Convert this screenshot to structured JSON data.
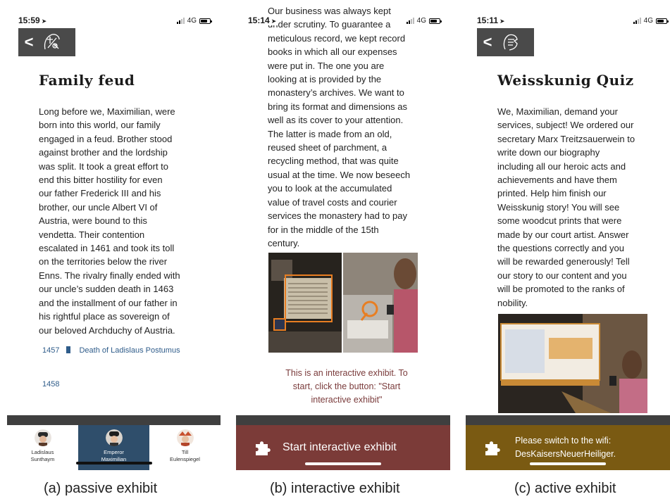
{
  "panels": {
    "passive": {
      "status": {
        "time": "15:59",
        "network": "4G"
      },
      "title": "Family feud",
      "body": "Long before we, Maximilian, were\nborn into this world, our family\nengaged in a feud. Brother stood\nagainst brother and the lordship\nwas split. It took a great effort to\nend this bitter hostility for even\nour father Frederick III and his\nbrother, our uncle Albert VI of\nAustria, were bound to this\nvendetta. Their contention\nescalated in 1461 and took its toll\non the territories below the river\nEnns. The rivalry finally ended with\nour uncle’s sudden death in 1463\nand the installment of our father in\nhis rightful place as sovereign of\nour beloved Archduchy of Austria.",
      "timeline": [
        {
          "year": "1457",
          "event": "Death of Ladislaus Postumus"
        },
        {
          "year": "1458",
          "event": ""
        }
      ],
      "tabs": [
        {
          "label_1": "Ladislaus",
          "label_2": "Sunthaym",
          "active": false
        },
        {
          "label_1": "Emperor",
          "label_2": "Maximilian",
          "active": true
        },
        {
          "label_1": "Till",
          "label_2": "Eulenspiegel",
          "active": false
        }
      ]
    },
    "interactive": {
      "status": {
        "time": "15:14",
        "network": "4G"
      },
      "body": "Our business was always kept\nunder scrutiny. To guarantee a\nmeticulous record, we kept record\nbooks in which all our expenses\nwere put in. The one you are\nlooking at is provided by the\nmonastery’s archives. We want to\nbring its format and dimensions as\nwell as its cover to your attention.\nThe latter is made from an old,\nreused sheet of parchment, a\nrecycling method, that was quite\nusual at the time. We now beseech\nyou to look at the accumulated\nvalue of travel costs and courier\nservices the monastery had to pay\nfor in the middle of the 15th\ncentury.",
      "notice": "This is an interactive exhibit. To\nstart, click the button: \"Start\ninteractive exhibit\"",
      "button_label": "Start interactive exhibit"
    },
    "active": {
      "status": {
        "time": "15:11",
        "network": "4G"
      },
      "title": "Weisskunig Quiz",
      "body": "We, Maximilian, demand your\nservices, subject! We ordered our\nsecretary Marx Treitzsauerwein to\nwrite down our biography\nincluding all our heroic acts and\nachievements and have them\nprinted. Help him finish our\nWeisskunig story! You will see\nsome woodcut prints that were\nmade by our court artist. Answer\nthe questions correctly and you\nwill be rewarded generously! Tell\nour story to our content and you\nwill be promoted to the ranks of\nnobility.",
      "wifi_notice": "Please switch to the wifi:\nDesKaisersNeuerHeiliger."
    }
  },
  "captions": {
    "a": "(a)  passive exhibit",
    "b": "(b)  interactive exhibit",
    "c": "(c)  active exhibit"
  },
  "colors": {
    "navbar": "#4a4a4a",
    "timeline_blue": "#2f5c8a",
    "tab_active": "#2f4e6b",
    "interactive_bar": "#7b3b38",
    "active_bar": "#7a5a12",
    "notice_red": "#7a3b3b"
  },
  "icons": {
    "back": "chevron-left-icon",
    "puzzle": "puzzle-piece-icon"
  }
}
